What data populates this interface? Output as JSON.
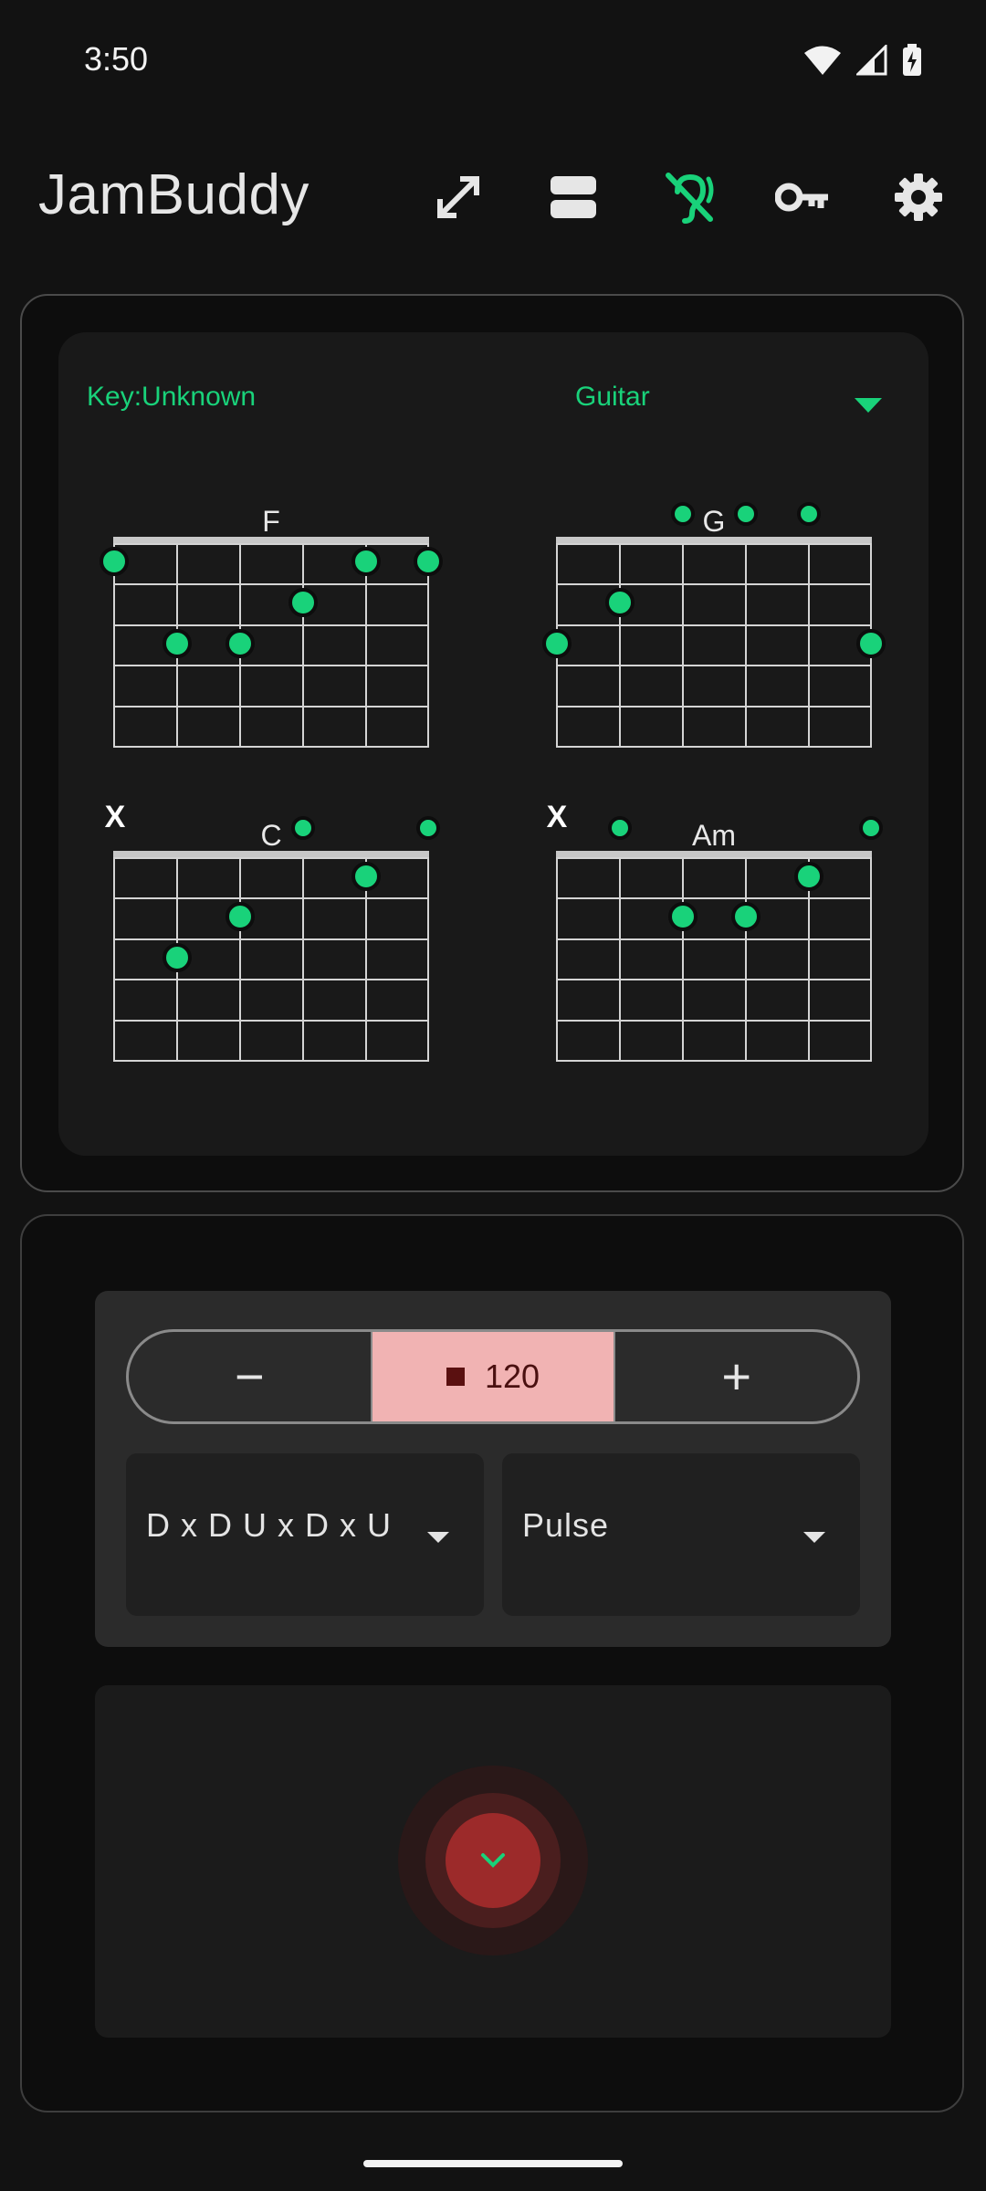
{
  "status_bar": {
    "time": "3:50",
    "icons": [
      "wifi-icon",
      "signal-icon",
      "battery-charging-icon"
    ]
  },
  "app_bar": {
    "title": "JamBuddy",
    "actions": [
      "expand-icon",
      "layout-icon",
      "hearing-off-icon",
      "key-icon",
      "settings-icon"
    ],
    "active_color": "#19d27a"
  },
  "chords_card": {
    "key_label": "Key:Unknown",
    "instrument": "Guitar",
    "chords": [
      {
        "name": "F",
        "muted_marker": ""
      },
      {
        "name": "G",
        "muted_marker": ""
      },
      {
        "name": "C",
        "muted_marker": "X"
      },
      {
        "name": "Am",
        "muted_marker": "X"
      }
    ]
  },
  "controls": {
    "decrement_label": "−",
    "tempo": "120",
    "increment_label": "+",
    "pattern": "D x D U x D x U",
    "sound": "Pulse"
  },
  "colors": {
    "accent": "#19d27a",
    "tempo_bg": "#f1b3b3",
    "strum_button": "#9c2a2a"
  }
}
